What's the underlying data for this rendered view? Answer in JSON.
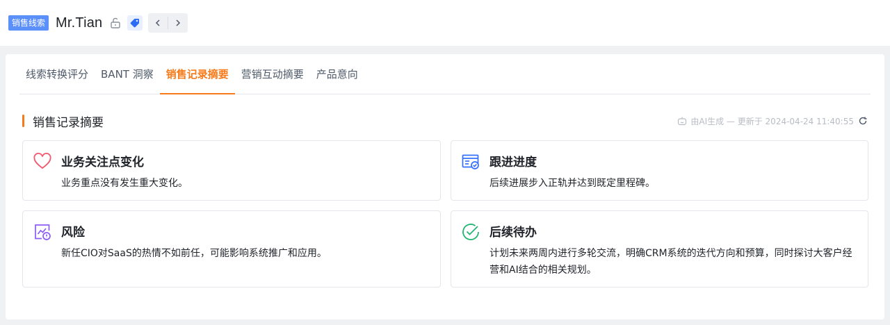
{
  "header": {
    "tag_label": "销售线索",
    "title": "Mr.Tian"
  },
  "tabs": [
    {
      "label": "线索转换评分",
      "active": false
    },
    {
      "label": "BANT 洞察",
      "active": false
    },
    {
      "label": "销售记录摘要",
      "active": true
    },
    {
      "label": "营销互动摘要",
      "active": false
    },
    {
      "label": "产品意向",
      "active": false
    }
  ],
  "section": {
    "title": "销售记录摘要",
    "ai_meta": "由AI生成 — 更新于 2024-04-24 11:40:55"
  },
  "boxes": [
    {
      "title": "业务关注点变化",
      "text": "业务重点没有发生重大变化。",
      "icon": "heart-icon"
    },
    {
      "title": "跟进进度",
      "text": "后续进展步入正轨并达到既定里程碑。",
      "icon": "progress-check-icon"
    },
    {
      "title": "风险",
      "text": "新任CIO对SaaS的热情不如前任，可能影响系统推广和应用。",
      "icon": "risk-chart-icon"
    },
    {
      "title": "后续待办",
      "text": "计划未来两周内进行多轮交流，明确CRM系统的迭代方向和预算，同时探讨大客户经营和AI结合的相关规划。",
      "icon": "check-circle-icon"
    }
  ],
  "colors": {
    "accent": "#f77a1a",
    "tag_bg": "#5b8ff9",
    "heart": "#f05a6e",
    "progress": "#3370ff",
    "risk": "#8b5cf6",
    "done": "#22b573"
  }
}
